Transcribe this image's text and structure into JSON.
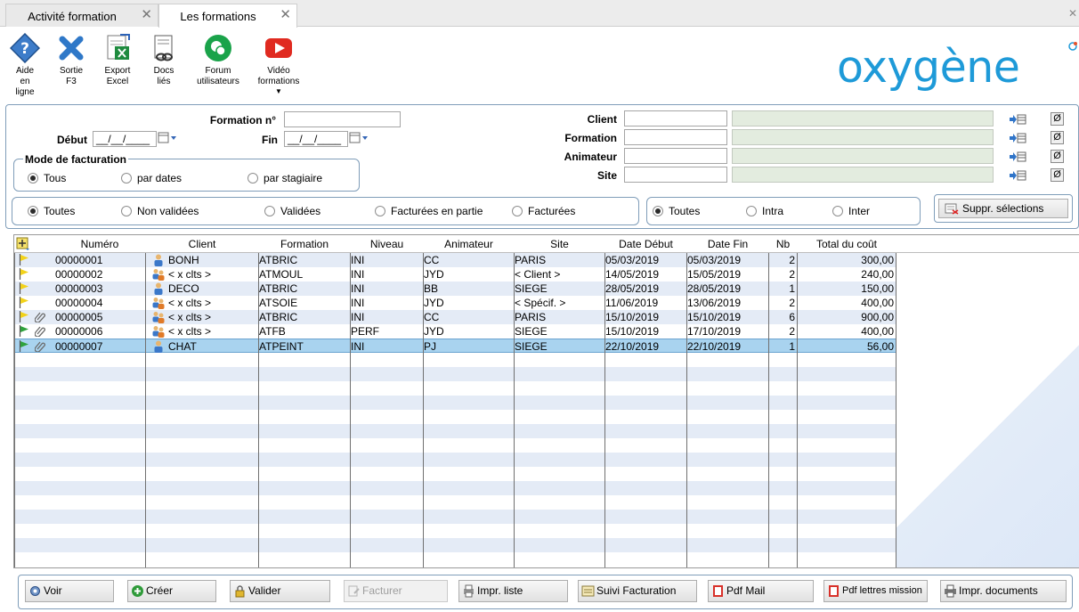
{
  "tabs": [
    {
      "label": "Activité formation",
      "active": false
    },
    {
      "label": "Les formations",
      "active": true
    }
  ],
  "toolbar": {
    "aide": [
      "Aide",
      "en",
      "ligne"
    ],
    "sortie": [
      "Sortie",
      "F3"
    ],
    "export": [
      "Export",
      "Excel"
    ],
    "docs": [
      "Docs",
      "liés"
    ],
    "forum": [
      "Forum",
      "utilisateurs"
    ],
    "video": [
      "Vidéo",
      "formations"
    ]
  },
  "logo": {
    "text": "oxygène",
    "color": "#1e9ad8"
  },
  "filters": {
    "formation_no_label": "Formation n°",
    "formation_no_value": "",
    "debut_label": "Début",
    "debut_value": "__/__/____",
    "fin_label": "Fin",
    "fin_value": "__/__/____",
    "client_label": "Client",
    "formation_label": "Formation",
    "animateur_label": "Animateur",
    "site_label": "Site",
    "null_symbol": "Ø",
    "mode_facturation": {
      "legend": "Mode de facturation",
      "options": [
        "Tous",
        "par dates",
        "par stagiaire"
      ],
      "selected": 0
    },
    "validation": {
      "options": [
        "Toutes",
        "Non validées",
        "Validées",
        "Facturées en partie",
        "Facturées"
      ],
      "selected": 0
    },
    "type": {
      "options": [
        "Toutes",
        "Intra",
        "Inter"
      ],
      "selected": 0
    },
    "suppr_label": "Suppr. sélections"
  },
  "grid": {
    "columns": [
      "Numéro",
      "Client",
      "Formation",
      "Niveau",
      "Animateur",
      "Site",
      "Date Début",
      "Date Fin",
      "Nb",
      "Total du coût"
    ],
    "rows": [
      {
        "flag": "yellow",
        "clip": false,
        "client_icon": "single",
        "numero": "00000001",
        "client": "BONH",
        "formation": "ATBRIC",
        "niveau": "INI",
        "animateur": "CC",
        "site": "PARIS",
        "debut": "05/03/2019",
        "fin": "05/03/2019",
        "nb": "2",
        "total": "300,00"
      },
      {
        "flag": "yellow",
        "clip": false,
        "client_icon": "multi",
        "numero": "00000002",
        "client": "< x clts >",
        "formation": "ATMOUL",
        "niveau": "INI",
        "animateur": "JYD",
        "site": "< Client >",
        "debut": "14/05/2019",
        "fin": "15/05/2019",
        "nb": "2",
        "total": "240,00"
      },
      {
        "flag": "yellow",
        "clip": false,
        "client_icon": "single",
        "numero": "00000003",
        "client": "DECO",
        "formation": "ATBRIC",
        "niveau": "INI",
        "animateur": "BB",
        "site": "SIEGE",
        "debut": "28/05/2019",
        "fin": "28/05/2019",
        "nb": "1",
        "total": "150,00"
      },
      {
        "flag": "yellow",
        "clip": false,
        "client_icon": "multi",
        "numero": "00000004",
        "client": "< x clts >",
        "formation": "ATSOIE",
        "niveau": "INI",
        "animateur": "JYD",
        "site": "< Spécif. >",
        "debut": "11/06/2019",
        "fin": "13/06/2019",
        "nb": "2",
        "total": "400,00"
      },
      {
        "flag": "yellow",
        "clip": true,
        "client_icon": "multi",
        "numero": "00000005",
        "client": "< x clts >",
        "formation": "ATBRIC",
        "niveau": "INI",
        "animateur": "CC",
        "site": "PARIS",
        "debut": "15/10/2019",
        "fin": "15/10/2019",
        "nb": "6",
        "total": "900,00"
      },
      {
        "flag": "green",
        "clip": true,
        "client_icon": "multi",
        "numero": "00000006",
        "client": "< x clts >",
        "formation": "ATFB",
        "niveau": "PERF",
        "animateur": "JYD",
        "site": "SIEGE",
        "debut": "15/10/2019",
        "fin": "17/10/2019",
        "nb": "2",
        "total": "400,00"
      },
      {
        "flag": "green",
        "clip": true,
        "client_icon": "single",
        "numero": "00000007",
        "client": "CHAT",
        "formation": "ATPEINT",
        "niveau": "INI",
        "animateur": "PJ",
        "site": "SIEGE",
        "debut": "22/10/2019",
        "fin": "22/10/2019",
        "nb": "1",
        "total": "56,00",
        "selected": true
      }
    ]
  },
  "bottom_buttons": {
    "voir": "Voir",
    "creer": "Créer",
    "valider": "Valider",
    "facturer": "Facturer",
    "impr_liste": "Impr. liste",
    "suivi": "Suivi Facturation",
    "pdf_mail": "Pdf Mail",
    "pdf_lettres": "Pdf lettres mission",
    "impr_docs": "Impr. documents"
  }
}
